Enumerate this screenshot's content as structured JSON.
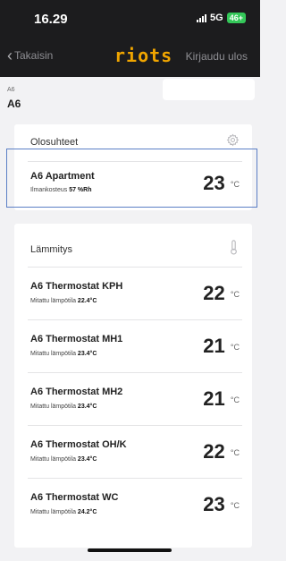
{
  "status_bar": {
    "time": "16.29",
    "network": "5G",
    "battery": "46+"
  },
  "nav": {
    "back_label": "Takaisin",
    "logo": "riots",
    "logout_label": "Kirjaudu ulos"
  },
  "breadcrumb": {
    "parent": "A6",
    "title": "A6"
  },
  "conditions": {
    "header": "Olosuhteet",
    "item": {
      "name": "A6 Apartment",
      "sub_label": "Ilmankosteus",
      "sub_value": "57 %Rh",
      "temp": "23",
      "unit": "°C"
    }
  },
  "heating": {
    "header": "Lämmitys",
    "items": [
      {
        "name": "A6 Thermostat KPH",
        "sub_label": "Mitattu lämpötila",
        "sub_value": "22.4°C",
        "temp": "22",
        "unit": "°C"
      },
      {
        "name": "A6 Thermostat MH1",
        "sub_label": "Mitattu lämpötila",
        "sub_value": "23.4°C",
        "temp": "21",
        "unit": "°C"
      },
      {
        "name": "A6 Thermostat MH2",
        "sub_label": "Mitattu lämpötila",
        "sub_value": "23.4°C",
        "temp": "21",
        "unit": "°C"
      },
      {
        "name": "A6 Thermostat OH/K",
        "sub_label": "Mitattu lämpötila",
        "sub_value": "23.4°C",
        "temp": "22",
        "unit": "°C"
      },
      {
        "name": "A6 Thermostat WC",
        "sub_label": "Mitattu lämpötila",
        "sub_value": "24.2°C",
        "temp": "23",
        "unit": "°C"
      }
    ]
  },
  "colors": {
    "accent": "#f0a500",
    "highlight": "#5b7fc6",
    "topbar": "#1c1c1e"
  }
}
